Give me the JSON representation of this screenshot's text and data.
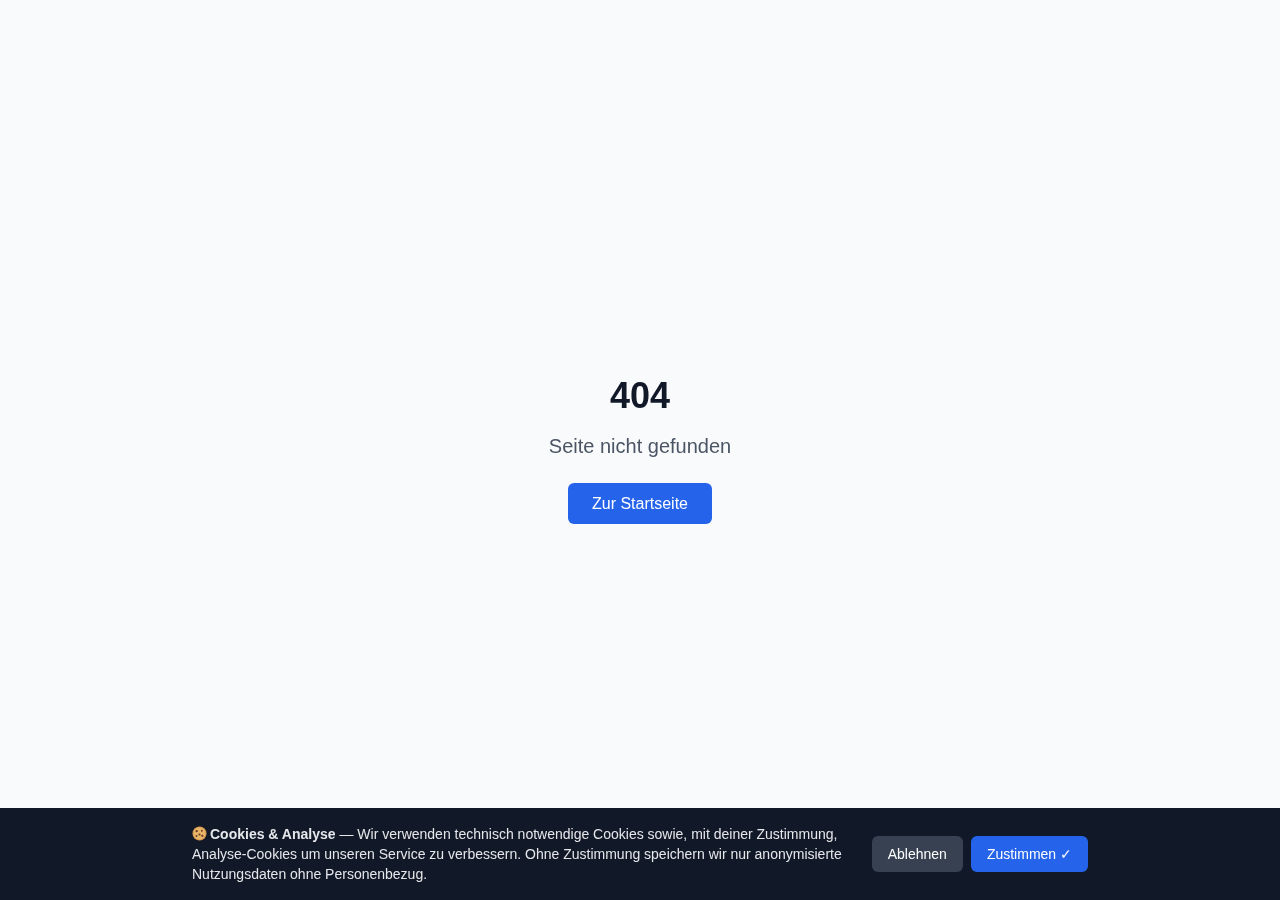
{
  "error_page": {
    "code": "404",
    "message": "Seite nicht gefunden",
    "home_button": "Zur Startseite"
  },
  "cookie_banner": {
    "text": "**Cookies & Analyse** — Wir verwenden technisch notwendige Cookies sowie, mit deiner Zustimmung, Analyse-Cookies um unseren Service zu verbessern. Ohne Zustimmung speichern wir nur anonymisierte Nutzungsdaten ohne Personenbezug.",
    "buttons": [
      {
        "label": "Ablehnen",
        "kind": "secondary"
      },
      {
        "label": "Zustimmen ✓",
        "kind": "primary"
      }
    ]
  }
}
